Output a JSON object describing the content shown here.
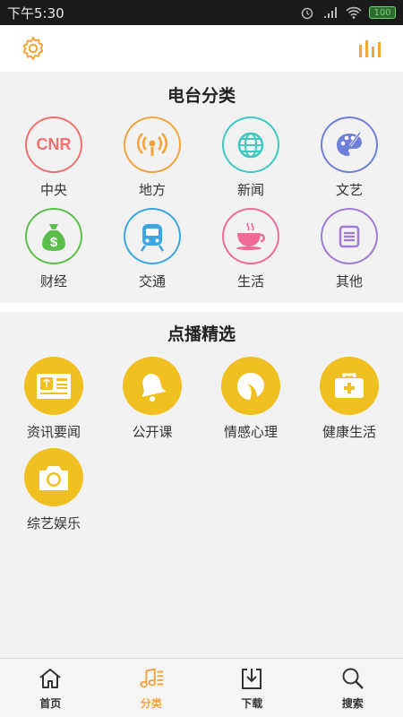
{
  "status_bar": {
    "time": "下午5:30",
    "battery": "100"
  },
  "header": {
    "settings_icon": "gear-icon",
    "equalizer_icon": "equalizer-icon"
  },
  "radio_categories": {
    "title": "电台分类",
    "items": [
      {
        "label": "中央",
        "icon": "cnr-text",
        "text": "CNR",
        "color": "#f07070"
      },
      {
        "label": "地方",
        "icon": "broadcast-icon",
        "color": "#f2a33a"
      },
      {
        "label": "新闻",
        "icon": "globe-icon",
        "color": "#3ec9c0"
      },
      {
        "label": "文艺",
        "icon": "palette-icon",
        "color": "#6f7fd8"
      },
      {
        "label": "财经",
        "icon": "money-bag-icon",
        "color": "#5cbf4a"
      },
      {
        "label": "交通",
        "icon": "train-icon",
        "color": "#3aa7e0"
      },
      {
        "label": "生活",
        "icon": "coffee-cup-icon",
        "color": "#ef6b95"
      },
      {
        "label": "其他",
        "icon": "list-icon",
        "color": "#a07ad6"
      }
    ]
  },
  "on_demand": {
    "title": "点播精选",
    "items": [
      {
        "label": "资讯要闻",
        "icon": "newspaper-icon"
      },
      {
        "label": "公开课",
        "icon": "bell-icon"
      },
      {
        "label": "情感心理",
        "icon": "leaf-icon"
      },
      {
        "label": "健康生活",
        "icon": "first-aid-kit-icon"
      },
      {
        "label": "综艺娱乐",
        "icon": "camera-icon"
      }
    ]
  },
  "bottom_nav": {
    "active_color": "#f2a33a",
    "items": [
      {
        "label": "首页",
        "icon": "home-icon"
      },
      {
        "label": "分类",
        "icon": "music-list-icon"
      },
      {
        "label": "下载",
        "icon": "download-icon"
      },
      {
        "label": "搜索",
        "icon": "search-icon"
      }
    ]
  }
}
